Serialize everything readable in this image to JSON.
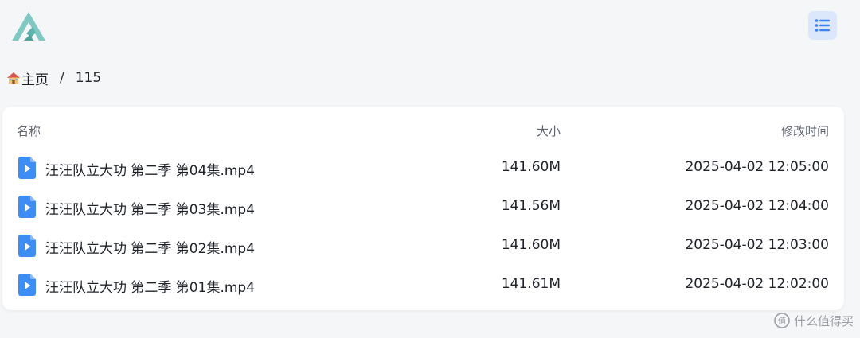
{
  "header": {
    "logo_icon": "mountain-logo-icon",
    "view_toggle_icon": "list-icon",
    "accent": "#3b82f6"
  },
  "breadcrumb": {
    "home_icon": "house-icon",
    "home_label": "主页",
    "separator": "/",
    "current": "115"
  },
  "table": {
    "columns": {
      "name": "名称",
      "size": "大小",
      "modified": "修改时间"
    },
    "rows": [
      {
        "name": "汪汪队立大功 第二季 第04集.mp4",
        "size": "141.60M",
        "modified": "2025-04-02 12:05:00",
        "icon": "video-file-icon"
      },
      {
        "name": "汪汪队立大功 第二季 第03集.mp4",
        "size": "141.56M",
        "modified": "2025-04-02 12:04:00",
        "icon": "video-file-icon"
      },
      {
        "name": "汪汪队立大功 第二季 第02集.mp4",
        "size": "141.60M",
        "modified": "2025-04-02 12:03:00",
        "icon": "video-file-icon"
      },
      {
        "name": "汪汪队立大功 第二季 第01集.mp4",
        "size": "141.61M",
        "modified": "2025-04-02 12:02:00",
        "icon": "video-file-icon"
      }
    ]
  },
  "watermark": {
    "text": "什么值得买",
    "icon": "zhi-logo-icon"
  }
}
